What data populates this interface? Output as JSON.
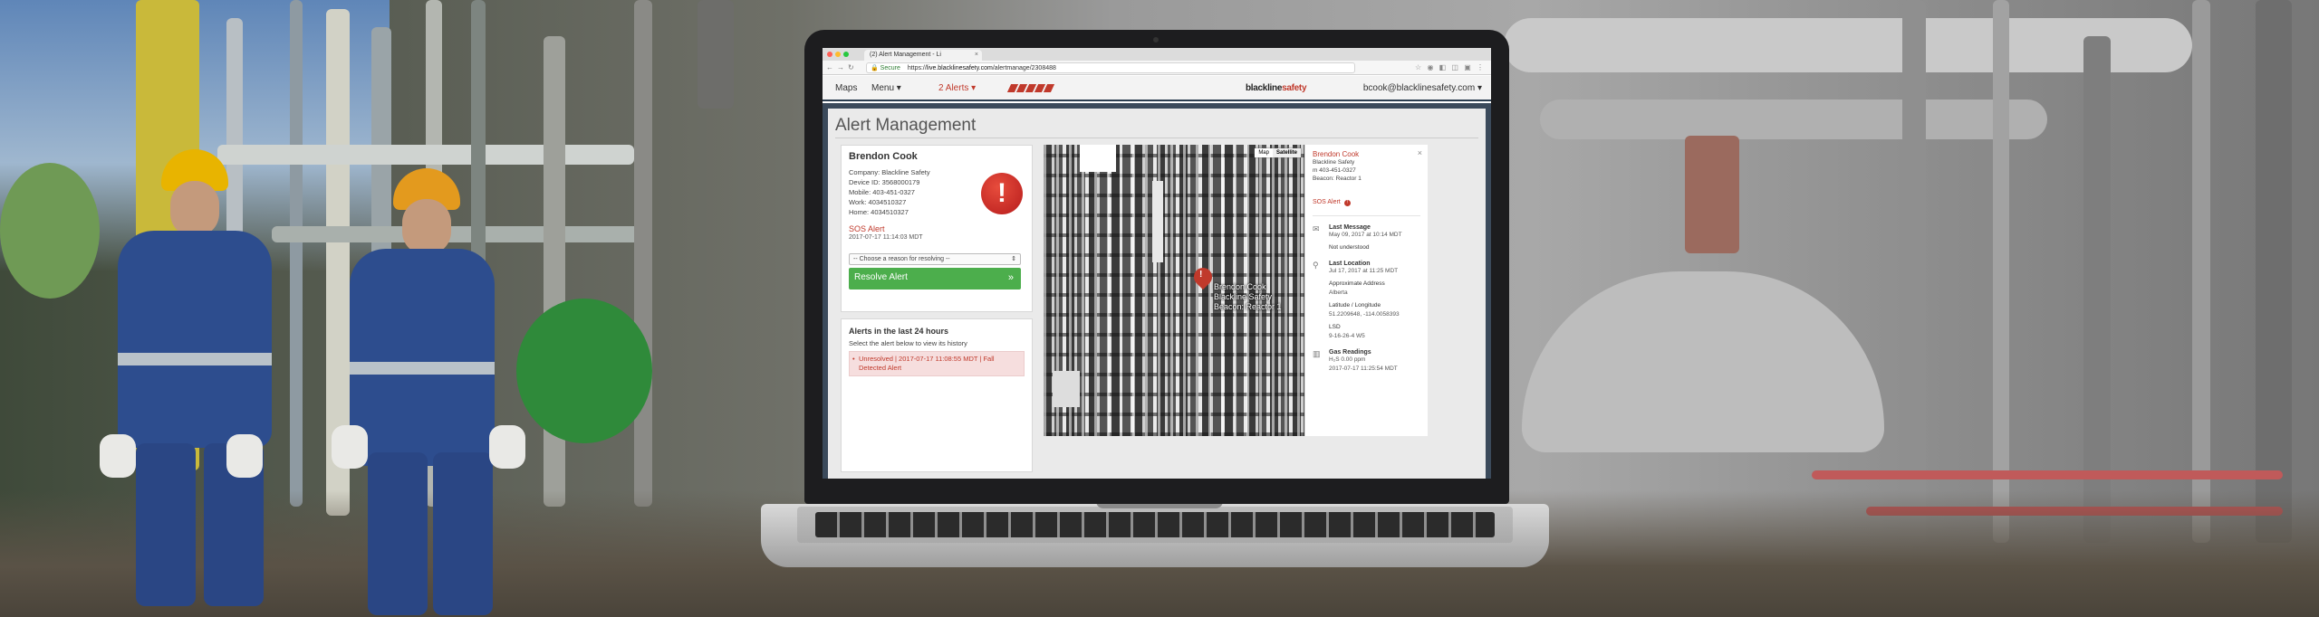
{
  "browser": {
    "tab_title": "(2) Alert Management - Li",
    "secure_label": "Secure",
    "url_prefix": "https://",
    "url_host": "live.blacklinesafety.com",
    "url_path": "/alertmanage/2308488"
  },
  "navbar": {
    "maps": "Maps",
    "menu": "Menu ▾",
    "alerts": "2 Alerts ▾",
    "brand_main": "blackline",
    "brand_accent": "safety",
    "user": "bcook@blacklinesafety.com ▾"
  },
  "page": {
    "title": "Alert Management"
  },
  "person": {
    "name": "Brendon Cook",
    "company": "Company: Blackline Safety",
    "device": "Device ID: 3568000179",
    "mobile": "Mobile: 403-451-0327",
    "work": "Work: 4034510327",
    "home": "Home: 4034510327",
    "alert_type": "SOS Alert",
    "alert_time": "2017-07-17 11:14:03 MDT",
    "select_placeholder": "-- Choose a reason for resolving --",
    "resolve_label": "Resolve Alert",
    "resolve_arrow": "»",
    "badge_symbol": "!"
  },
  "history": {
    "title": "Alerts in the last 24 hours",
    "subtitle": "Select the alert below to view its history",
    "items": [
      {
        "text": "Unresolved | 2017-07-17 11:08:55 MDT | Fall Detected Alert"
      }
    ]
  },
  "map": {
    "toggle_map": "Map",
    "toggle_satellite": "Satellite",
    "label_name": "Brendon Cook",
    "label_company": "Blackline Safety",
    "label_beacon": "Beacon: Reactor 1",
    "pin_symbol": "!"
  },
  "side_panel": {
    "name": "Brendon Cook",
    "company": "Blackline Safety",
    "phone": "m 403-451-0327",
    "beacon": "Beacon: Reactor 1",
    "close": "×",
    "sos_label": "SOS Alert",
    "sections": {
      "last_message": {
        "heading": "Last Message",
        "time": "May 09, 2017 at 10:14 MDT",
        "text": "Not understood"
      },
      "last_location": {
        "heading": "Last Location",
        "time": "Jul 17, 2017 at 11:25 MDT",
        "approx_label": "Approximate Address",
        "approx_value": "Alberta",
        "latlng_label": "Latitude / Longitude",
        "latlng_value": "51.2209648, -114.0058393",
        "lsd_label": "LSD",
        "lsd_value": "9-16-26-4 W5"
      },
      "gas": {
        "heading": "Gas Readings",
        "value": "H₂S 0.00 ppm",
        "time": "2017-07-17 11:25:54 MDT"
      }
    }
  },
  "colors": {
    "accent_red": "#c0392b",
    "resolve_green": "#4cae4c",
    "nav_dark": "#2c3e50"
  }
}
